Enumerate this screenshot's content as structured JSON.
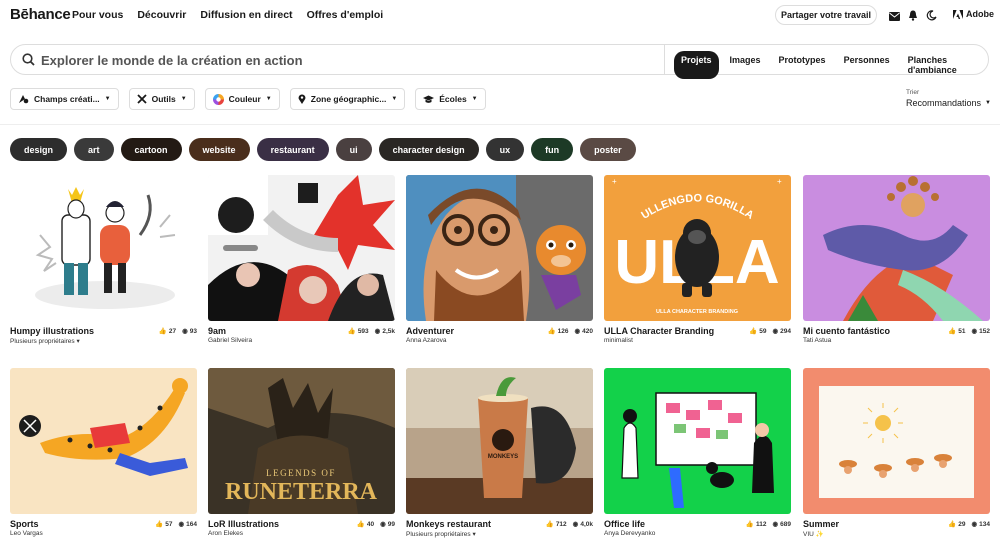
{
  "nav": {
    "logo": "Bēhance",
    "links": [
      "Pour vous",
      "Découvrir",
      "Diffusion en direct",
      "Offres d'emploi"
    ],
    "share_label": "Partager votre travail",
    "adobe_label": "Adobe"
  },
  "search": {
    "placeholder": "Explorer le monde de la création en action",
    "tabs": [
      "Projets",
      "Images",
      "Prototypes",
      "Personnes",
      "Planches d'ambiance"
    ],
    "active_tab": "Projets"
  },
  "filters": [
    "Champs créati...",
    "Outils",
    "Couleur",
    "Zone géographic...",
    "Écoles"
  ],
  "sort": {
    "label": "Trier",
    "value": "Recommandations"
  },
  "tags": [
    {
      "label": "design",
      "color": "#2d2d2d"
    },
    {
      "label": "art",
      "color": "#3a3a3a"
    },
    {
      "label": "cartoon",
      "color": "#231a14"
    },
    {
      "label": "website",
      "color": "#4a2e1c"
    },
    {
      "label": "restaurant",
      "color": "#3a2f45"
    },
    {
      "label": "ui",
      "color": "#4a4040"
    },
    {
      "label": "character design",
      "color": "#2a2724"
    },
    {
      "label": "ux",
      "color": "#333333"
    },
    {
      "label": "fun",
      "color": "#1d3a26"
    },
    {
      "label": "poster",
      "color": "#5a4a44"
    }
  ],
  "projects": [
    {
      "title": "Humpy illustrations",
      "owner": "Plusieurs propriétaires ▾",
      "likes": "27",
      "views": "93"
    },
    {
      "title": "9am",
      "owner": "Gabriel Silveira",
      "likes": "593",
      "views": "2,5k"
    },
    {
      "title": "Adventurer",
      "owner": "Anna Azarova",
      "likes": "126",
      "views": "420"
    },
    {
      "title": "ULLA Character Branding",
      "owner": "minimalist",
      "likes": "59",
      "views": "294"
    },
    {
      "title": "Mi cuento fantástico",
      "owner": "Tati Astua",
      "likes": "51",
      "views": "152"
    },
    {
      "title": "Sports",
      "owner": "Leo Vargas",
      "likes": "57",
      "views": "164"
    },
    {
      "title": "LoR Illustrations",
      "owner": "Aron Elekes",
      "likes": "40",
      "views": "99"
    },
    {
      "title": "Monkeys restaurant",
      "owner": "Plusieurs propriétaires ▾",
      "likes": "712",
      "views": "4,0k"
    },
    {
      "title": "Office life",
      "owner": "Anya Derevyanko",
      "likes": "112",
      "views": "689"
    },
    {
      "title": "Summer",
      "owner": "VIU ✨",
      "likes": "29",
      "views": "134"
    }
  ],
  "art_text": {
    "ulla_arc": "ULLENGDO GORILLA",
    "ulla_big": "ULLA",
    "ulla_caption": "ULLA CHARACTER BRANDING",
    "lor_top": "LEGENDS OF",
    "lor_main": "RUNETERRA",
    "monkeys_cup": "MONKEYS"
  },
  "icons": {
    "search": "search-icon",
    "mail": "mail-icon",
    "bell": "bell-icon",
    "moon": "moon-icon",
    "like": "thumbs-up-icon",
    "view": "eye-icon"
  }
}
